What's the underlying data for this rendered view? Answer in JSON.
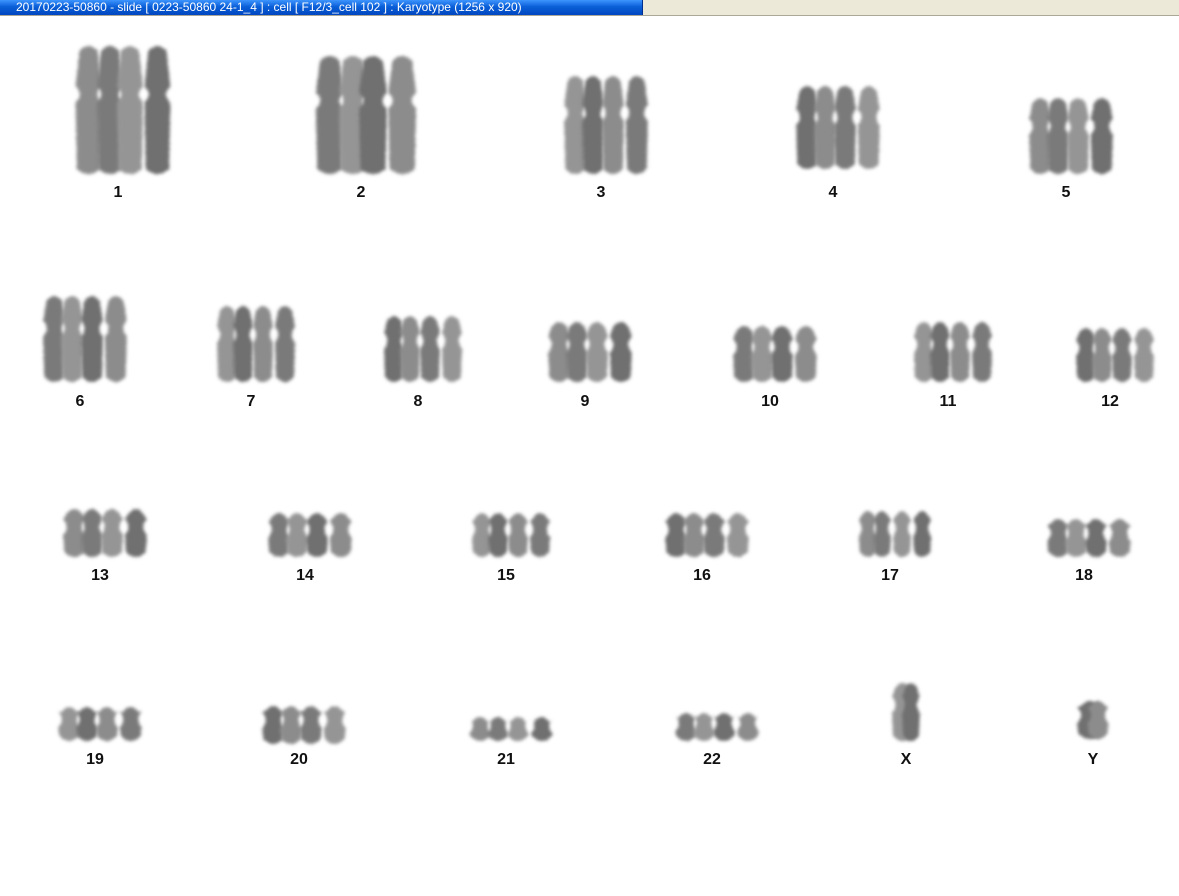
{
  "window": {
    "title": "20170223-50860 - slide [ 0223-50860 24-1_4 ] : cell [ F12/3_cell 102 ] : Karyotype  (1256 x 920)"
  },
  "karyotype": {
    "labels": [
      "1",
      "2",
      "3",
      "4",
      "5",
      "6",
      "7",
      "8",
      "9",
      "10",
      "11",
      "12",
      "13",
      "14",
      "15",
      "16",
      "17",
      "18",
      "19",
      "20",
      "21",
      "22",
      "X",
      "Y"
    ]
  }
}
